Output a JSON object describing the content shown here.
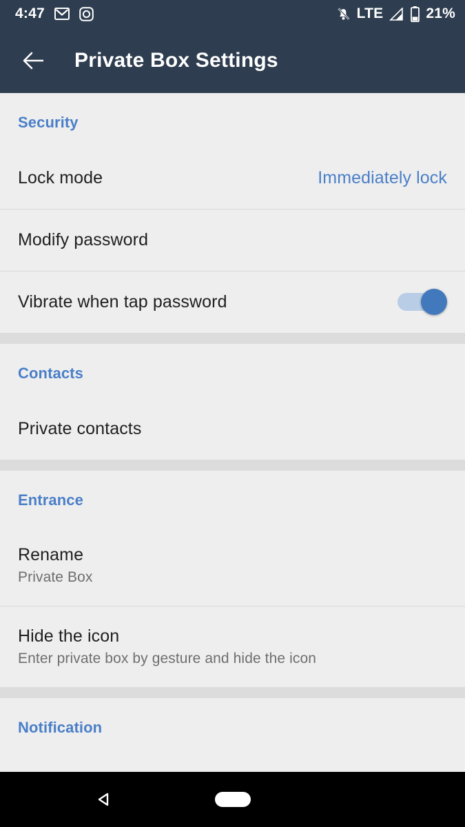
{
  "status_bar": {
    "time": "4:47",
    "network": "LTE",
    "battery_percent": "21%",
    "icons": [
      "gmail-icon",
      "instagram-icon",
      "notifications-off-icon",
      "signal-icon",
      "battery-icon"
    ],
    "background_color": "#2e3d4f"
  },
  "app_bar": {
    "back_icon": "back-arrow-icon",
    "title": "Private Box Settings",
    "background_color": "#2e3d4f"
  },
  "accent_color": "#4a7fc8",
  "sections": [
    {
      "header": "Security",
      "rows": [
        {
          "title": "Lock mode",
          "value": "Immediately lock",
          "type": "value"
        },
        {
          "title": "Modify password",
          "type": "plain"
        },
        {
          "title": "Vibrate when tap password",
          "type": "switch",
          "switch_on": true
        }
      ]
    },
    {
      "header": "Contacts",
      "rows": [
        {
          "title": "Private contacts",
          "type": "plain"
        }
      ]
    },
    {
      "header": "Entrance",
      "rows": [
        {
          "title": "Rename",
          "subtitle": "Private Box",
          "type": "subtitle"
        },
        {
          "title": "Hide the icon",
          "subtitle": "Enter private box by gesture and hide the icon",
          "type": "subtitle"
        }
      ]
    },
    {
      "header": "Notification",
      "rows": []
    }
  ],
  "nav_bar": {
    "back_icon": "nav-back-triangle-icon",
    "home_icon": "nav-home-pill-icon",
    "background_color": "#000000"
  }
}
